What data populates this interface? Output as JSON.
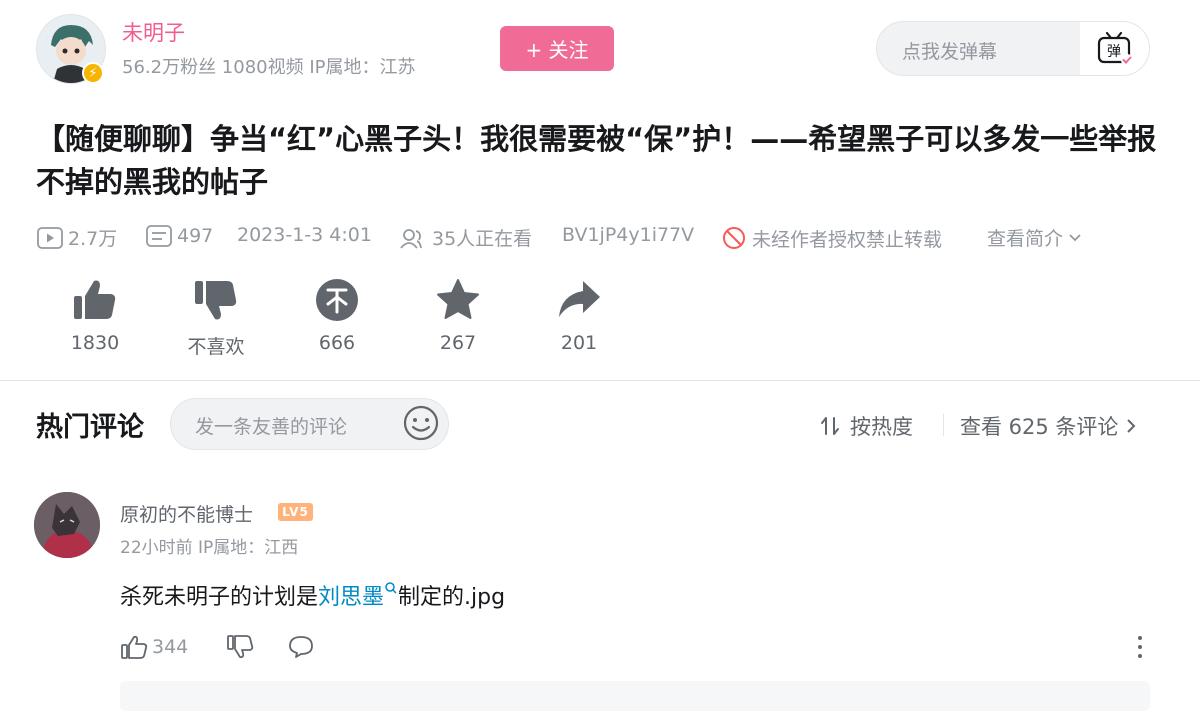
{
  "author": {
    "name": "未明子",
    "meta": "56.2万粉丝 1080视频 IP属地：江苏",
    "follow_label": "+ 关注"
  },
  "danmaku": {
    "placeholder": "点我发弹幕",
    "button_label": "弹"
  },
  "video": {
    "title": "【随便聊聊】争当“红”心黑子头！我很需要被“保”护！——希望黑子可以多发一些举报不掉的黑我的帖子",
    "views": "2.7万",
    "danmaku_count": "497",
    "datetime": "2023-1-3  4:01",
    "watching": "35人正在看",
    "bvid": "BV1jP4y1i77V",
    "copyright": "未经作者授权禁止转载",
    "intro_label": "查看简介"
  },
  "actions": [
    {
      "name": "like",
      "label": "1830"
    },
    {
      "name": "dislike",
      "label": "不喜欢"
    },
    {
      "name": "coin",
      "label": "666"
    },
    {
      "name": "favorite",
      "label": "267"
    },
    {
      "name": "share",
      "label": "201"
    }
  ],
  "comments": {
    "header": "热门评论",
    "input_placeholder": "发一条友善的评论",
    "sort_label": "按热度",
    "view_all": "查看 625 条评论",
    "items": [
      {
        "user": "原初的不能博士",
        "level": "LV5",
        "meta": "22小时前  IP属地：江西",
        "text_before": "杀死未明子的计划是",
        "link_text": "刘思墨",
        "text_after": "制定的.jpg",
        "likes": "344"
      }
    ]
  },
  "colors": {
    "brand_pink": "#f06c96",
    "name_pink": "#f25d8e",
    "link_blue": "#008ac5",
    "muted": "#9499a0"
  }
}
